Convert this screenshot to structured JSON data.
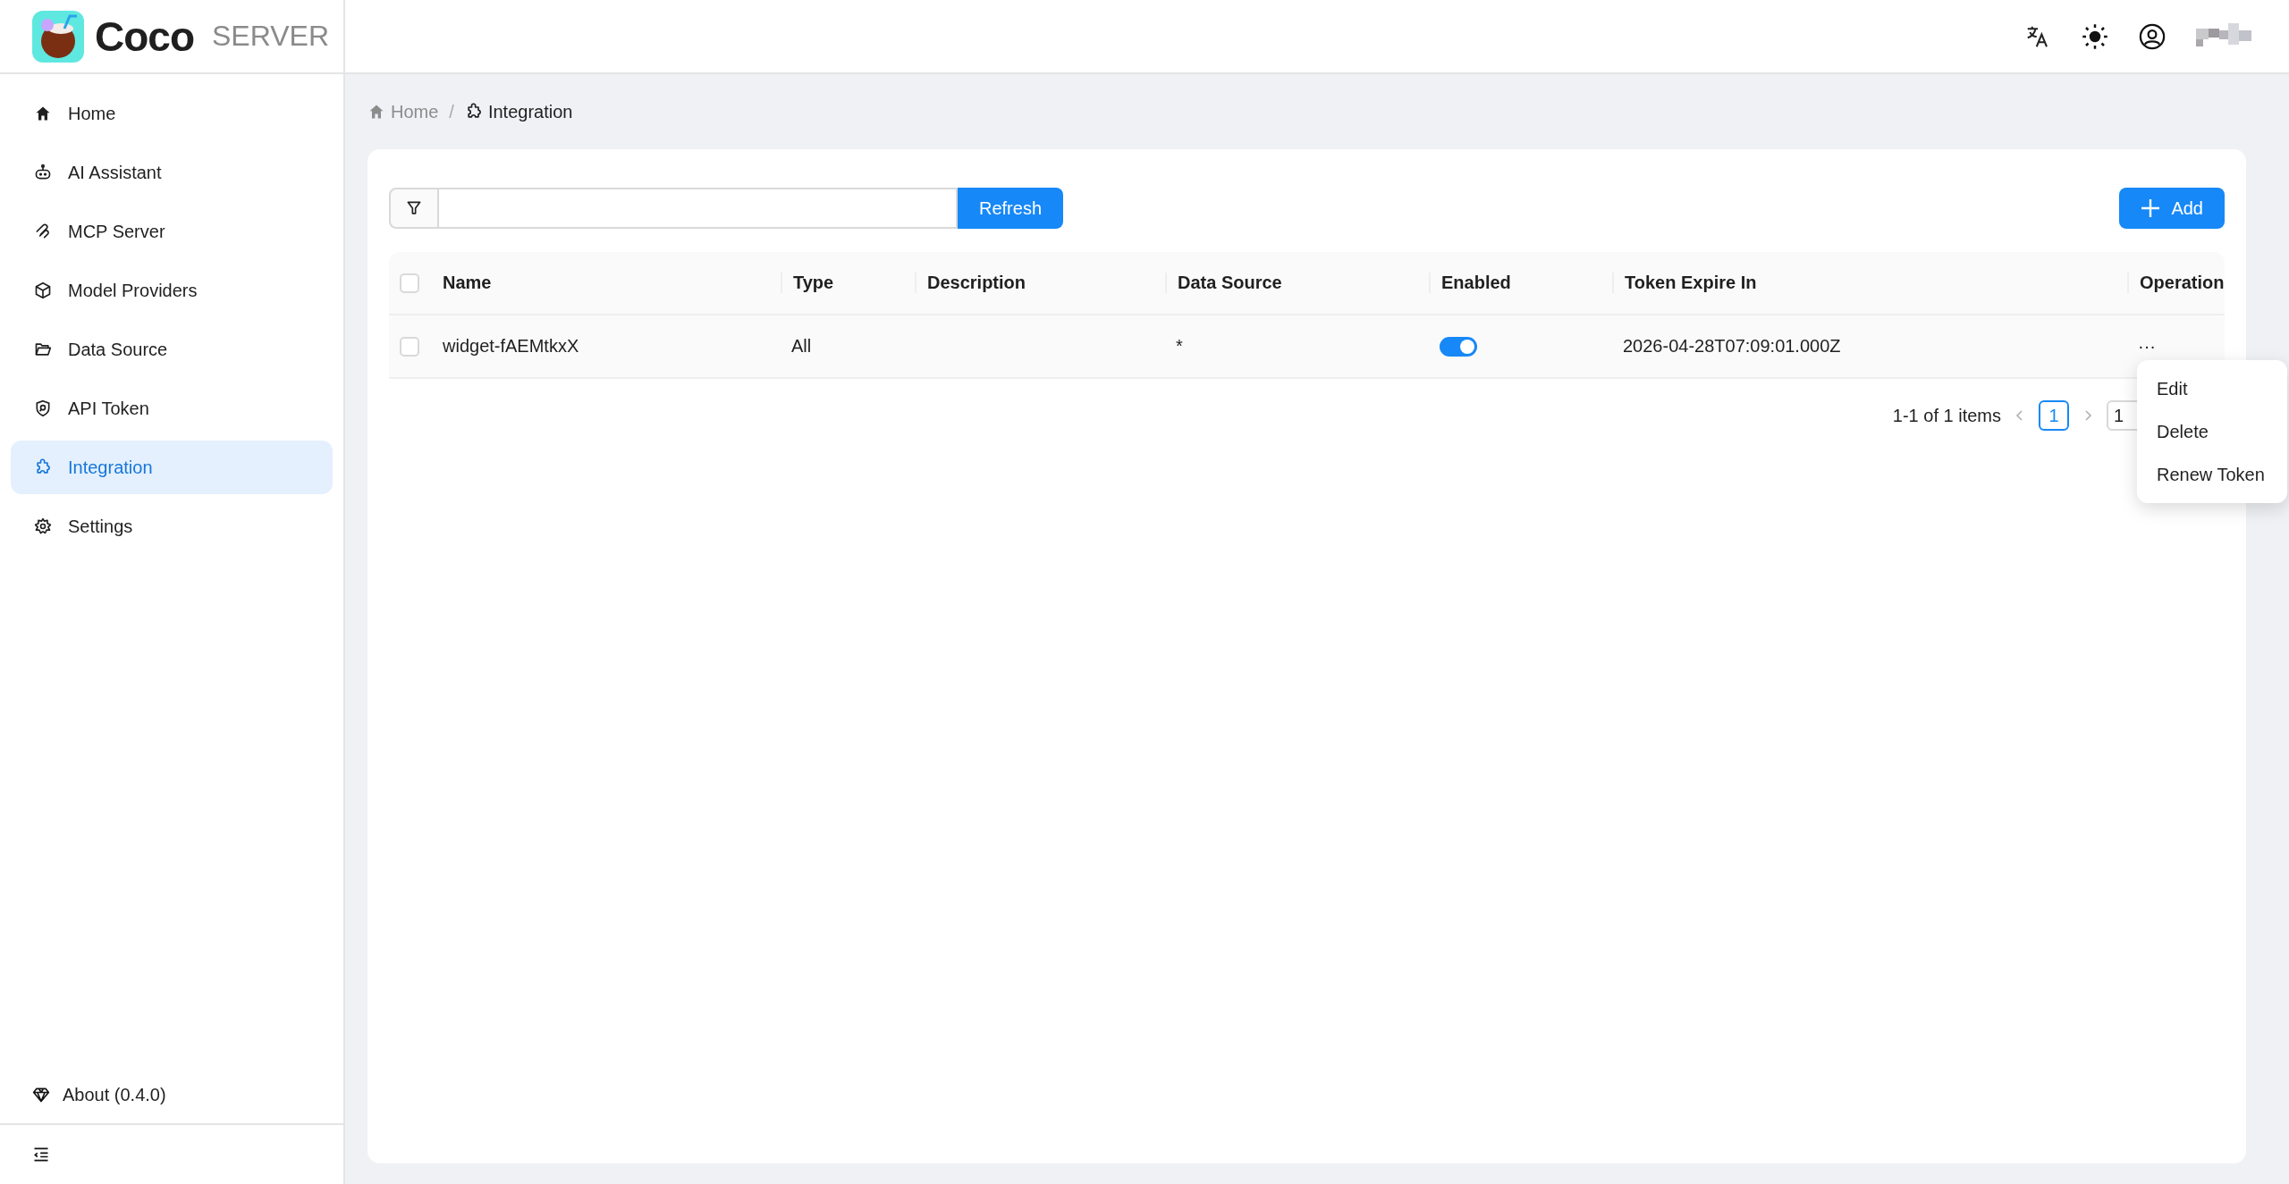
{
  "brand": {
    "name": "Coco",
    "suffix": "SERVER"
  },
  "sidebar": {
    "items": [
      {
        "label": "Home",
        "selected": false
      },
      {
        "label": "AI Assistant",
        "selected": false
      },
      {
        "label": "MCP Server",
        "selected": false
      },
      {
        "label": "Model Providers",
        "selected": false
      },
      {
        "label": "Data Source",
        "selected": false
      },
      {
        "label": "API Token",
        "selected": false
      },
      {
        "label": "Integration",
        "selected": true
      },
      {
        "label": "Settings",
        "selected": false
      }
    ],
    "about": "About (0.4.0)"
  },
  "breadcrumb": {
    "separator": "/",
    "items": [
      {
        "label": "Home"
      },
      {
        "label": "Integration"
      }
    ]
  },
  "toolbar": {
    "refresh": "Refresh",
    "add": "Add"
  },
  "table": {
    "all_checked": false,
    "columns": [
      "Name",
      "Type",
      "Description",
      "Data Source",
      "Enabled",
      "Token Expire In",
      "Operation"
    ],
    "rows": [
      {
        "checked": false,
        "name": "widget-fAEMtkxX",
        "type": "All",
        "data_source": "*",
        "enabled": true,
        "token_expire_in": "2026-04-28T07:09:01.000Z",
        "operation": "···"
      }
    ]
  },
  "pagination": {
    "summary": "1-1 of 1 items",
    "pages": [
      {
        "label": "1",
        "selected": true
      }
    ],
    "page_size": "1"
  },
  "menu": {
    "items": [
      "Edit",
      "Delete",
      "Renew Token"
    ]
  }
}
